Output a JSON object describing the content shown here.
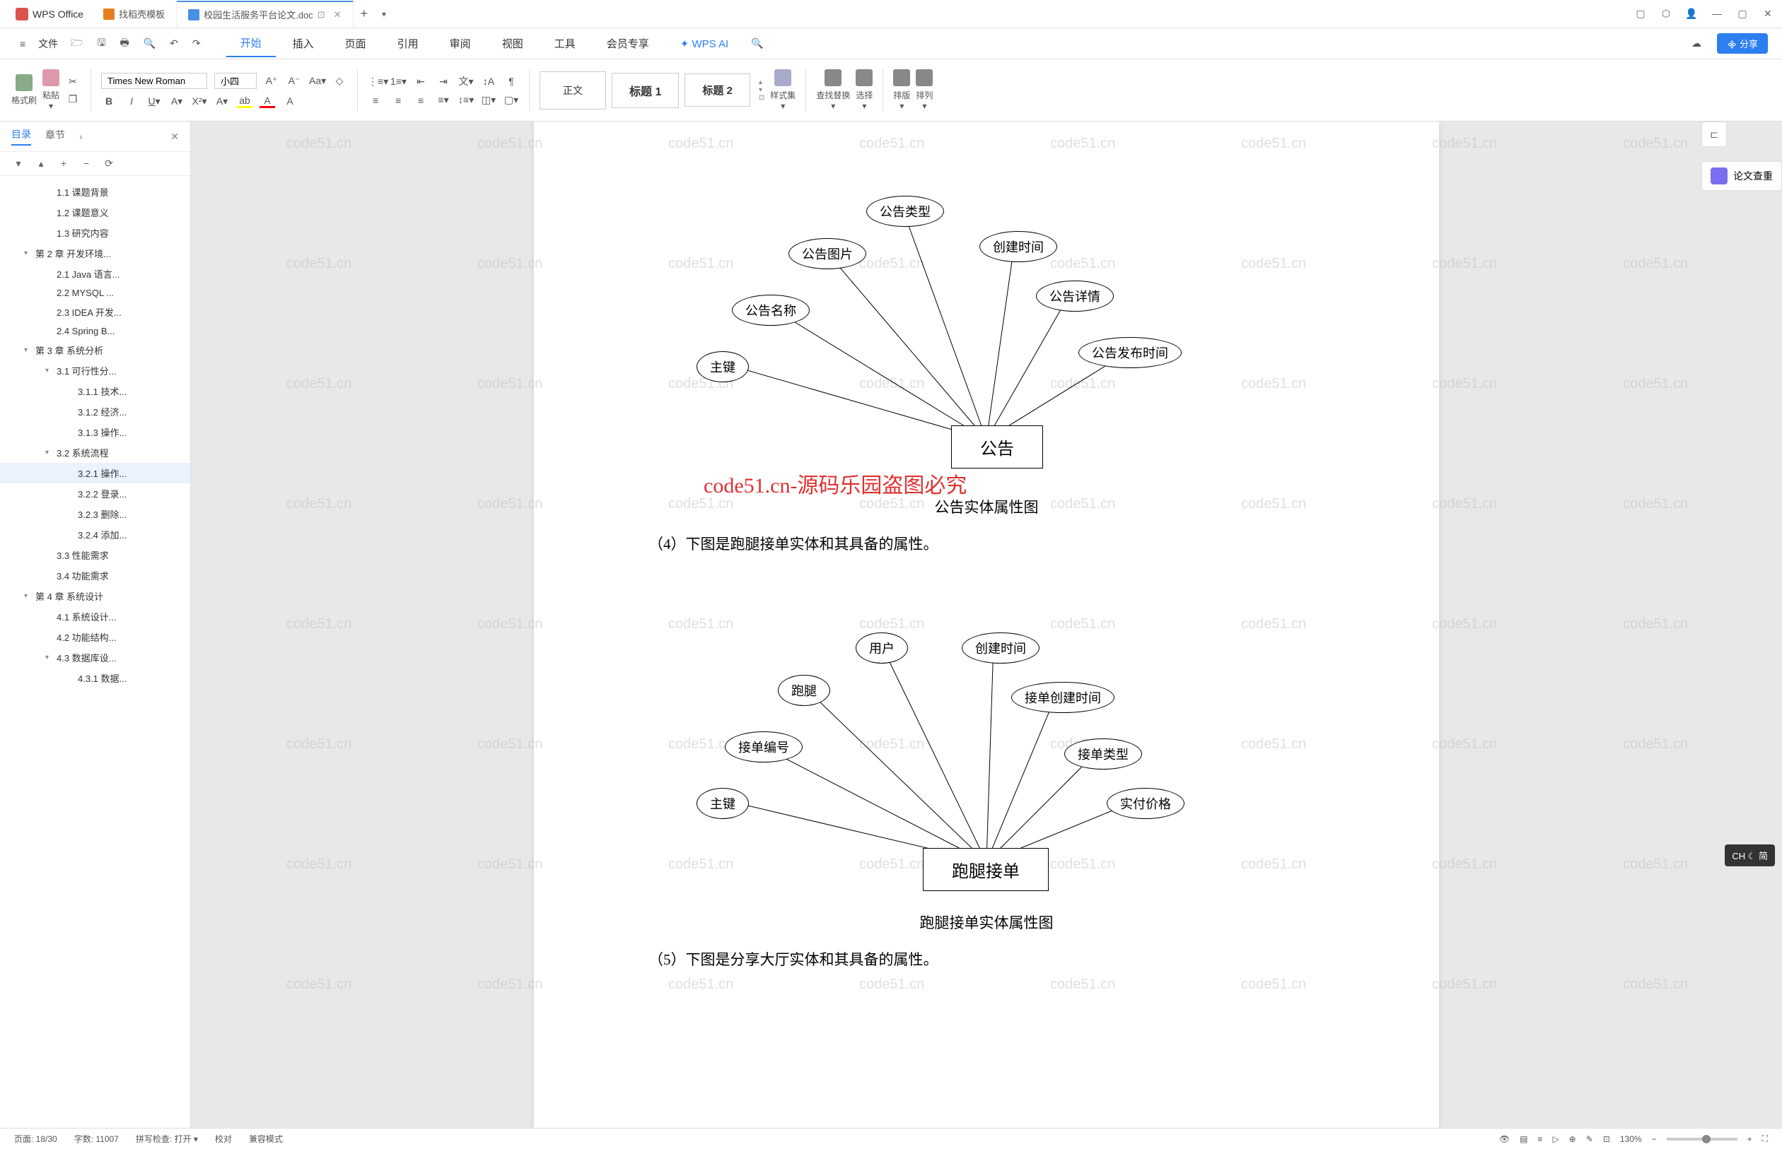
{
  "app": {
    "name": "WPS Office"
  },
  "tabs": [
    {
      "label": "找稻壳模板",
      "icon": "d"
    },
    {
      "label": "校园生活服务平台论文.doc",
      "icon": "doc",
      "active": true
    }
  ],
  "menu": {
    "file": "文件",
    "items": [
      "开始",
      "插入",
      "页面",
      "引用",
      "审阅",
      "视图",
      "工具",
      "会员专享",
      "WPS AI"
    ],
    "active": "开始",
    "share": "分享"
  },
  "ribbon": {
    "format_brush": "格式刷",
    "paste": "粘贴",
    "font": "Times New Roman",
    "size": "小四",
    "normal_style": "正文",
    "heading1": "标题 1",
    "heading2": "标题 2",
    "styles": "样式集",
    "find_replace": "查找替换",
    "select": "选择",
    "arrange": "排版",
    "align": "排列"
  },
  "sidebar": {
    "tab_toc": "目录",
    "tab_chapter": "章节",
    "items": [
      {
        "label": "1.1 课题背景",
        "level": 2
      },
      {
        "label": "1.2 课题意义",
        "level": 2
      },
      {
        "label": "1.3 研究内容",
        "level": 2
      },
      {
        "label": "第 2 章 开发环境...",
        "level": 1,
        "expandable": true
      },
      {
        "label": "2.1 Java 语言...",
        "level": 2
      },
      {
        "label": "2.2 MYSQL ...",
        "level": 2
      },
      {
        "label": "2.3 IDEA 开发...",
        "level": 2
      },
      {
        "label": "2.4 Spring B...",
        "level": 2
      },
      {
        "label": "第 3 章 系统分析",
        "level": 1,
        "expandable": true
      },
      {
        "label": "3.1 可行性分...",
        "level": 2,
        "expandable": true
      },
      {
        "label": "3.1.1 技术...",
        "level": 3
      },
      {
        "label": "3.1.2 经济...",
        "level": 3
      },
      {
        "label": "3.1.3 操作...",
        "level": 3
      },
      {
        "label": "3.2 系统流程",
        "level": 2,
        "expandable": true
      },
      {
        "label": "3.2.1 操作...",
        "level": 3,
        "active": true
      },
      {
        "label": "3.2.2 登录...",
        "level": 3
      },
      {
        "label": "3.2.3 删除...",
        "level": 3
      },
      {
        "label": "3.2.4 添加...",
        "level": 3
      },
      {
        "label": "3.3 性能需求",
        "level": 2
      },
      {
        "label": "3.4 功能需求",
        "level": 2
      },
      {
        "label": "第 4 章 系统设计",
        "level": 1,
        "expandable": true
      },
      {
        "label": "4.1 系统设计...",
        "level": 2
      },
      {
        "label": "4.2 功能结构...",
        "level": 2
      },
      {
        "label": "4.3 数据库设...",
        "level": 2,
        "expandable": true
      },
      {
        "label": "4.3.1 数据...",
        "level": 3
      }
    ]
  },
  "document": {
    "diagram1": {
      "entity": "公告",
      "attrs": [
        "主键",
        "公告名称",
        "公告图片",
        "公告类型",
        "创建时间",
        "公告详情",
        "公告发布时间"
      ],
      "caption": "公告实体属性图"
    },
    "watermark_text": "code51.cn-源码乐园盗图必究",
    "para1": "（4）下图是跑腿接单实体和其具备的属性。",
    "diagram2": {
      "entity": "跑腿接单",
      "attrs": [
        "主键",
        "接单编号",
        "跑腿",
        "用户",
        "创建时间",
        "接单创建时间",
        "接单类型",
        "实付价格"
      ],
      "caption": "跑腿接单实体属性图"
    },
    "para2": "（5）下图是分享大厅实体和其具备的属性。"
  },
  "right_panel": {
    "plagiarism": "论文查重"
  },
  "statusbar": {
    "page": "页面: 18/30",
    "words": "字数: 11007",
    "spell": "拼写检查: 打开",
    "proof": "校对",
    "compat": "兼容模式",
    "zoom": "130%"
  },
  "ime": "CH ☾ 简",
  "watermark": "code51.cn"
}
